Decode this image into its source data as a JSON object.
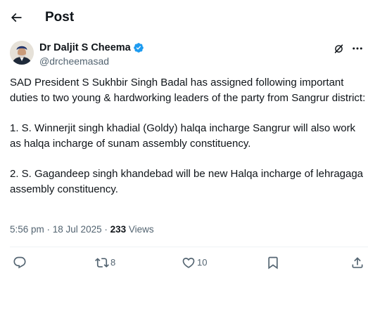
{
  "header": {
    "back_icon": "arrow-left-icon",
    "title": "Post"
  },
  "author": {
    "display_name": "Dr Daljit S Cheema",
    "handle": "@drcheemasad",
    "verified_icon": "verified-badge-icon",
    "verified_color": "#1d9bf0",
    "grok_icon": "grok-icon",
    "more_icon": "more-dots-icon"
  },
  "post": {
    "paragraphs": [
      "SAD President S Sukhbir Singh Badal has assigned following important duties to two young & hardworking leaders of the party from Sangrur district:",
      "1. S. Winnerjit singh khadial (Goldy) halqa incharge Sangrur will also work as halqa incharge of sunam assembly constituency.",
      "2. S. Gagandeep singh khandebad will be new Halqa incharge of lehragaga assembly constituency."
    ]
  },
  "meta": {
    "time": "5:56 pm",
    "separator1": " · ",
    "date": "18 Jul 2025",
    "separator2": " · ",
    "views_count": "233",
    "views_label": " Views"
  },
  "actions": {
    "reply": {
      "icon": "reply-icon",
      "count": ""
    },
    "repost": {
      "icon": "repost-icon",
      "count": "8"
    },
    "like": {
      "icon": "heart-icon",
      "count": "10"
    },
    "bookmark": {
      "icon": "bookmark-icon",
      "count": ""
    },
    "share": {
      "icon": "share-icon",
      "count": ""
    }
  },
  "colors": {
    "text_primary": "#0f1419",
    "text_secondary": "#536471",
    "divider": "#eff3f4",
    "accent": "#1d9bf0"
  }
}
